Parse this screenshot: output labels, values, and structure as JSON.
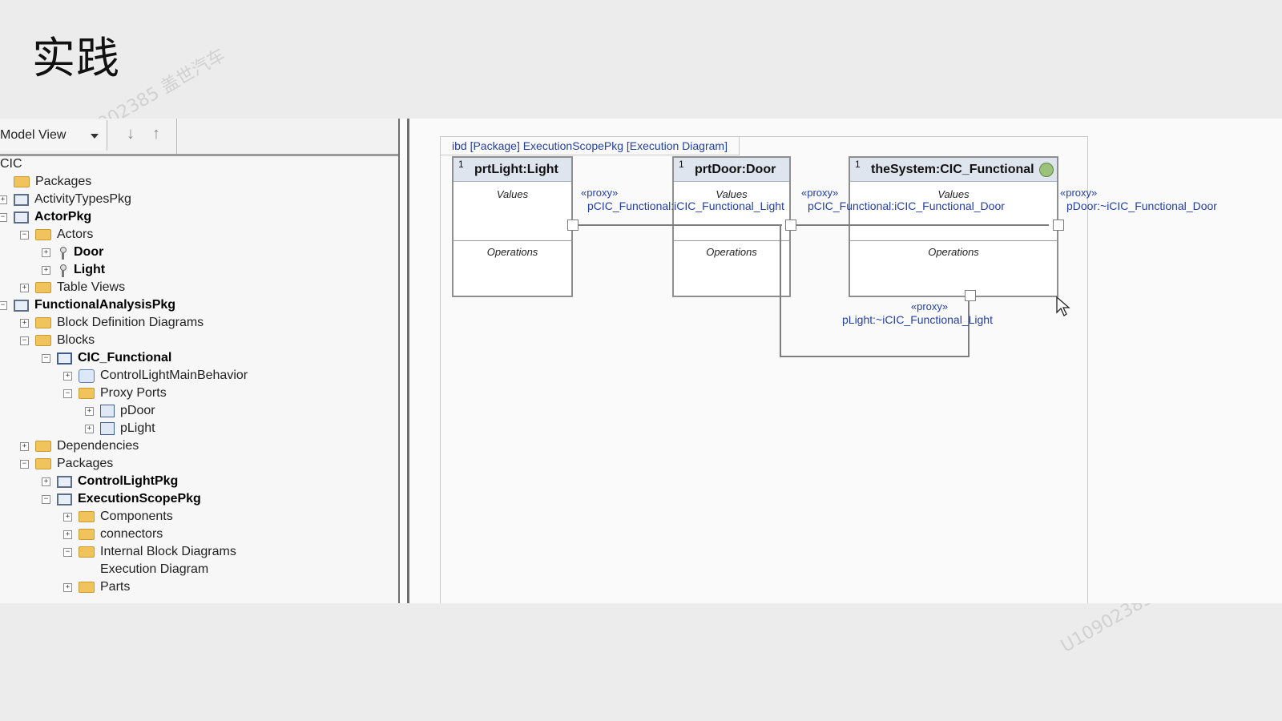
{
  "slide": {
    "title": "实践"
  },
  "watermark": {
    "text": "U10902385  盖世汽车"
  },
  "tree_panel": {
    "view_selector": "Model View",
    "root_label": "CIC",
    "items": [
      {
        "label": "Packages",
        "indent": 0,
        "icon": "folder-icon",
        "expander": "none",
        "bold": false
      },
      {
        "label": "ActivityTypesPkg",
        "indent": 0,
        "icon": "package-icon",
        "expander": "+",
        "bold": false
      },
      {
        "label": "ActorPkg",
        "indent": 0,
        "icon": "package-icon",
        "expander": "-",
        "bold": true
      },
      {
        "label": "Actors",
        "indent": 1,
        "icon": "folder-icon",
        "expander": "-",
        "bold": false
      },
      {
        "label": "Door",
        "indent": 2,
        "icon": "actor-icon",
        "expander": "+",
        "bold": true
      },
      {
        "label": "Light",
        "indent": 2,
        "icon": "actor-icon",
        "expander": "+",
        "bold": true
      },
      {
        "label": "Table Views",
        "indent": 1,
        "icon": "folder-icon",
        "expander": "+",
        "bold": false
      },
      {
        "label": "FunctionalAnalysisPkg",
        "indent": 0,
        "icon": "package-icon",
        "expander": "-",
        "bold": true
      },
      {
        "label": "Block Definition Diagrams",
        "indent": 1,
        "icon": "folder-icon",
        "expander": "+",
        "bold": false
      },
      {
        "label": "Blocks",
        "indent": 1,
        "icon": "folder-icon",
        "expander": "-",
        "bold": false
      },
      {
        "label": "CIC_Functional",
        "indent": 2,
        "icon": "block-icon",
        "expander": "-",
        "bold": true
      },
      {
        "label": "ControlLightMainBehavior",
        "indent": 3,
        "icon": "behavior-icon",
        "expander": "+",
        "bold": false
      },
      {
        "label": "Proxy Ports",
        "indent": 3,
        "icon": "folder-icon",
        "expander": "-",
        "bold": false
      },
      {
        "label": "pDoor",
        "indent": 4,
        "icon": "port-icon",
        "expander": "+",
        "bold": false
      },
      {
        "label": "pLight",
        "indent": 4,
        "icon": "port-icon",
        "expander": "+",
        "bold": false
      },
      {
        "label": "Dependencies",
        "indent": 1,
        "icon": "folder-icon",
        "expander": "+",
        "bold": false
      },
      {
        "label": "Packages",
        "indent": 1,
        "icon": "folder-icon",
        "expander": "-",
        "bold": false
      },
      {
        "label": "ControlLightPkg",
        "indent": 2,
        "icon": "package-icon",
        "expander": "+",
        "bold": true
      },
      {
        "label": "ExecutionScopePkg",
        "indent": 2,
        "icon": "package-icon",
        "expander": "-",
        "bold": true
      },
      {
        "label": "Components",
        "indent": 3,
        "icon": "folder-icon",
        "expander": "+",
        "bold": false
      },
      {
        "label": "connectors",
        "indent": 3,
        "icon": "folder-icon",
        "expander": "+",
        "bold": false
      },
      {
        "label": "Internal Block Diagrams",
        "indent": 3,
        "icon": "folder-icon",
        "expander": "-",
        "bold": false
      },
      {
        "label": "Execution Diagram",
        "indent": 4,
        "icon": "diagram-icon",
        "expander": "none",
        "bold": false
      },
      {
        "label": "Parts",
        "indent": 3,
        "icon": "folder-icon",
        "expander": "+",
        "bold": false
      }
    ]
  },
  "diagram": {
    "frame_title": "ibd [Package] ExecutionScopePkg [Execution Diagram]",
    "parts": [
      {
        "multiplicity": "1",
        "name": "prtLight:Light",
        "values_label": "Values",
        "operations_label": "Operations"
      },
      {
        "multiplicity": "1",
        "name": "prtDoor:Door",
        "values_label": "Values",
        "operations_label": "Operations"
      },
      {
        "multiplicity": "1",
        "name": "theSystem:CIC_Functional",
        "values_label": "Values",
        "operations_label": "Operations"
      }
    ],
    "ports": [
      {
        "stereotype": "«proxy»",
        "name": "pCIC_Functional:iCIC_Functional_Light"
      },
      {
        "stereotype": "«proxy»",
        "name": "pCIC_Functional:iCIC_Functional_Door"
      },
      {
        "stereotype": "«proxy»",
        "name": "pDoor:~iCIC_Functional_Door"
      },
      {
        "stereotype": "«proxy»",
        "name": "pLight:~iCIC_Functional_Light"
      }
    ]
  }
}
